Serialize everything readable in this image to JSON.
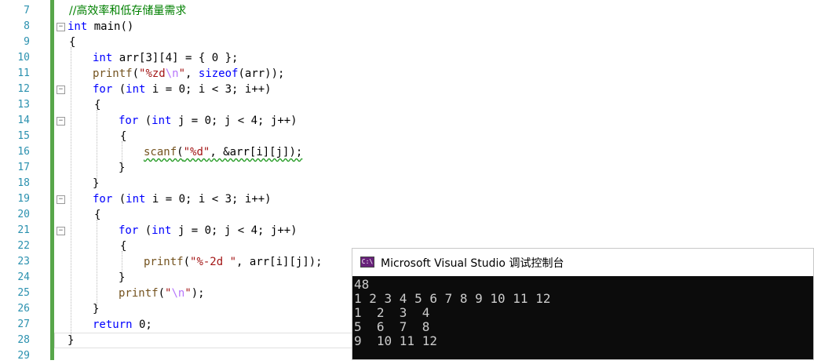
{
  "editor": {
    "line_numbers": [
      "7",
      "8",
      "9",
      "10",
      "11",
      "12",
      "13",
      "14",
      "15",
      "16",
      "17",
      "18",
      "19",
      "20",
      "21",
      "22",
      "23",
      "24",
      "25",
      "26",
      "27",
      "28",
      "29"
    ],
    "lines": {
      "l7_comment": "//高效率和低存储量需求",
      "l8_kw": "int",
      "l8_rest": " main()",
      "l9": "{",
      "l10_kw": "int",
      "l10_rest": " arr[3][4] = { 0 };",
      "l11_fn": "printf",
      "l11_a": "(",
      "l11_str1": "\"%zd",
      "l11_esc": "\\n",
      "l11_str2": "\"",
      "l11_b": ", ",
      "l11_kw": "sizeof",
      "l11_c": "(arr));",
      "l12_kw1": "for",
      "l12_a": " (",
      "l12_kw2": "int",
      "l12_rest": " i = 0; i < 3; i++)",
      "l13": "{",
      "l14_kw1": "for",
      "l14_a": " (",
      "l14_kw2": "int",
      "l14_rest": " j = 0; j < 4; j++)",
      "l15": "{",
      "l16_fn": "scanf",
      "l16_a": "(",
      "l16_str": "\"%d\"",
      "l16_rest": ", &arr[i][j]);",
      "l17": "}",
      "l18": "}",
      "l19_kw1": "for",
      "l19_a": " (",
      "l19_kw2": "int",
      "l19_rest": " i = 0; i < 3; i++)",
      "l20": "{",
      "l21_kw1": "for",
      "l21_a": " (",
      "l21_kw2": "int",
      "l21_rest": " j = 0; j < 4; j++)",
      "l22": "{",
      "l23_fn": "printf",
      "l23_a": "(",
      "l23_str": "\"%-2d \"",
      "l23_rest": ", arr[i][j]);",
      "l24": "}",
      "l25_fn": "printf",
      "l25_a": "(",
      "l25_str1": "\"",
      "l25_esc": "\\n",
      "l25_str2": "\"",
      "l25_rest": ");",
      "l26": "}",
      "l27_kw": "return",
      "l27_rest": " 0;",
      "l28": "}"
    }
  },
  "console": {
    "icon_text": "C:\\",
    "title": "Microsoft Visual Studio 调试控制台",
    "output": [
      "48",
      "1 2 3 4 5 6 7 8 9 10 11 12",
      "1  2  3  4",
      "5  6  7  8",
      "9  10 11 12"
    ]
  },
  "colors": {
    "keyword": "#0000ff",
    "string": "#a31515",
    "escape": "#b776fb",
    "comment": "#008000",
    "function": "#74531f",
    "line_number": "#2b91af",
    "change_bar": "#57a64a"
  }
}
